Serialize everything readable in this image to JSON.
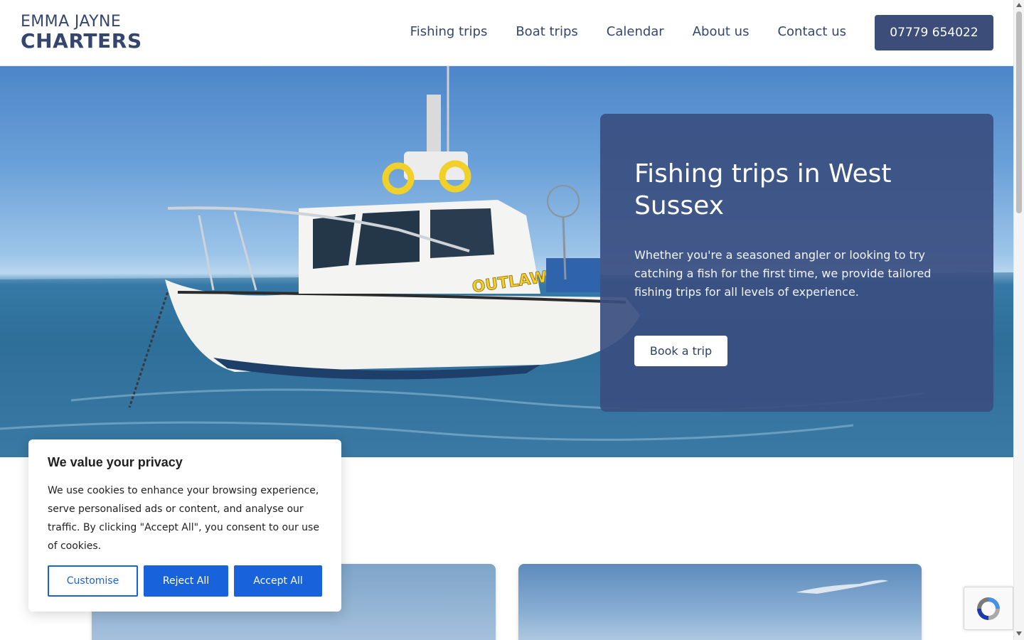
{
  "header": {
    "logo_line1": "EMMA JAYNE",
    "logo_line2": "CHARTERS",
    "nav": [
      "Fishing trips",
      "Boat trips",
      "Calendar",
      "About us",
      "Contact us"
    ],
    "phone": "07779 654022"
  },
  "hero": {
    "title": "Fishing trips in West Sussex",
    "text": "Whether you're a seasoned angler or looking to try catching a fish for the first time, we provide tailored fishing trips for all levels of experience.",
    "button": "Book a trip",
    "boat_name": "OUTLAW"
  },
  "cookie": {
    "title": "We value your privacy",
    "text": "We use cookies to enhance your browsing experience, serve personalised ads or content, and analyse our traffic. By clicking \"Accept All\", you consent to our use of cookies.",
    "customise": "Customise",
    "reject": "Reject All",
    "accept": "Accept All"
  },
  "colors": {
    "brand": "#3b4d78",
    "hero_card": "#3a4e80",
    "cookie_accent": "#1863dc"
  },
  "icons": {
    "recaptcha": "recaptcha-icon"
  }
}
